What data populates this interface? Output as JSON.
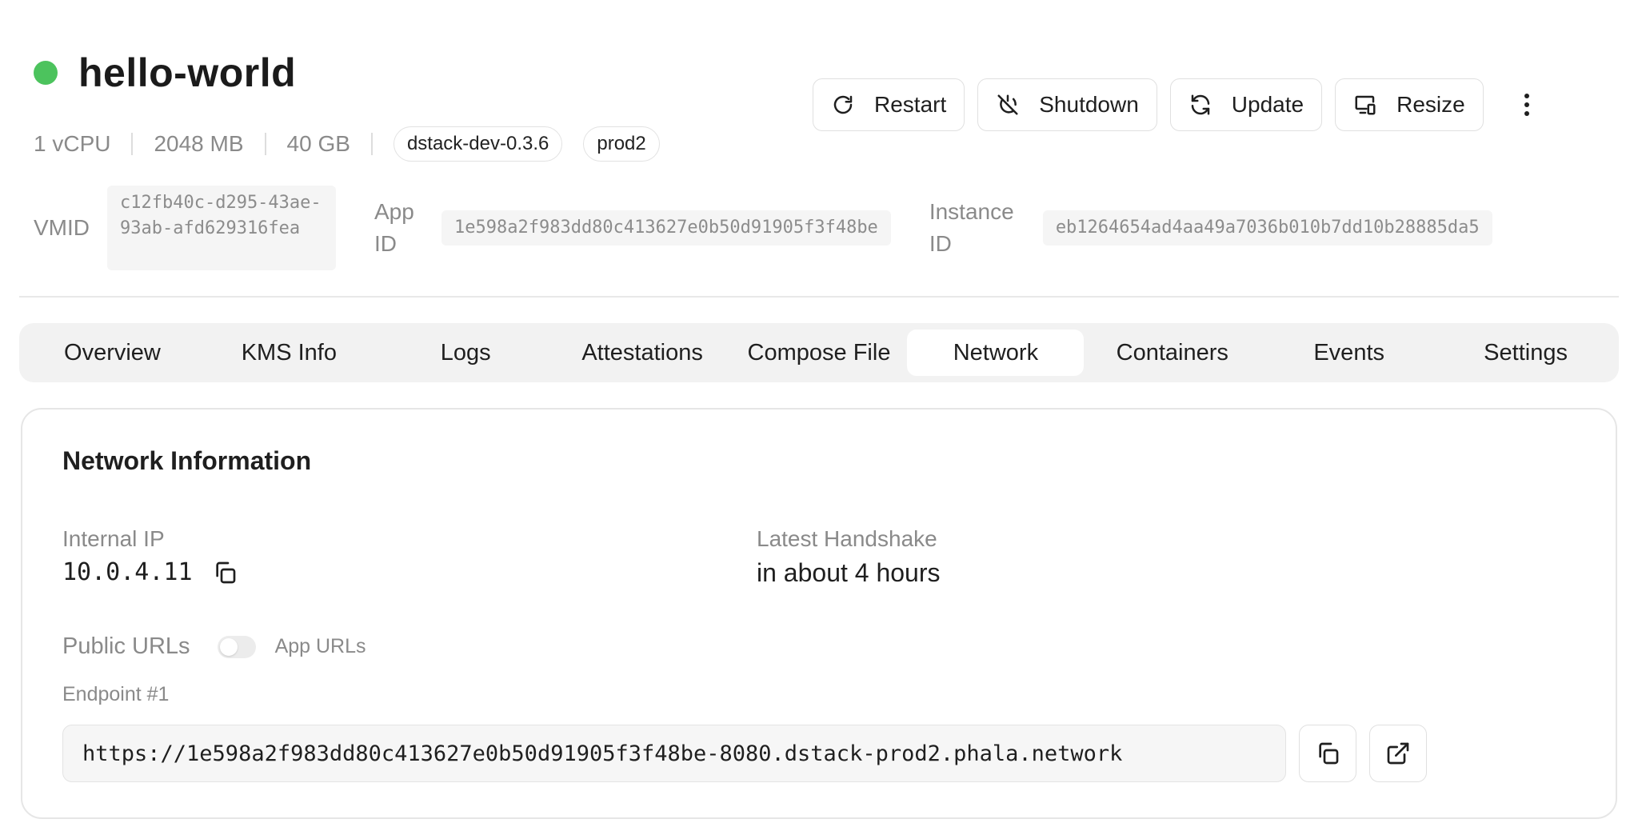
{
  "header": {
    "app_name": "hello-world",
    "status_color": "#4cc35d",
    "specs": {
      "vcpu": "1 vCPU",
      "memory": "2048 MB",
      "disk": "40 GB"
    },
    "tags": [
      "dstack-dev-0.3.6",
      "prod2"
    ]
  },
  "actions": {
    "restart": {
      "label": "Restart",
      "icon": "restart-icon"
    },
    "shutdown": {
      "label": "Shutdown",
      "icon": "power-off-icon"
    },
    "update": {
      "label": "Update",
      "icon": "refresh-icon"
    },
    "resize": {
      "label": "Resize",
      "icon": "resize-icon"
    },
    "more": {
      "icon": "more-vertical-icon"
    }
  },
  "ids": {
    "vmid_label": "VMID",
    "vmid_value": "c12fb40c-d295-43ae-93ab-afd629316fea",
    "app_id_label": "App ID",
    "app_id_value": "1e598a2f983dd80c413627e0b50d91905f3f48be",
    "instance_id_label": "Instance ID",
    "instance_id_value": "eb1264654ad4aa49a7036b010b7dd10b28885da5"
  },
  "tabs": [
    {
      "label": "Overview",
      "active": false
    },
    {
      "label": "KMS Info",
      "active": false
    },
    {
      "label": "Logs",
      "active": false
    },
    {
      "label": "Attestations",
      "active": false
    },
    {
      "label": "Compose File",
      "active": false
    },
    {
      "label": "Network",
      "active": true
    },
    {
      "label": "Containers",
      "active": false
    },
    {
      "label": "Events",
      "active": false
    },
    {
      "label": "Settings",
      "active": false
    }
  ],
  "network": {
    "title": "Network Information",
    "internal_ip_label": "Internal IP",
    "internal_ip_value": "10.0.4.11",
    "handshake_label": "Latest Handshake",
    "handshake_value": "in about 4 hours",
    "public_urls_label": "Public URLs",
    "app_urls_label": "App URLs",
    "app_urls_toggle_on": false,
    "endpoint_label": "Endpoint #1",
    "endpoint_url": "https://1e598a2f983dd80c413627e0b50d91905f3f48be-8080.dstack-prod2.phala.network"
  }
}
